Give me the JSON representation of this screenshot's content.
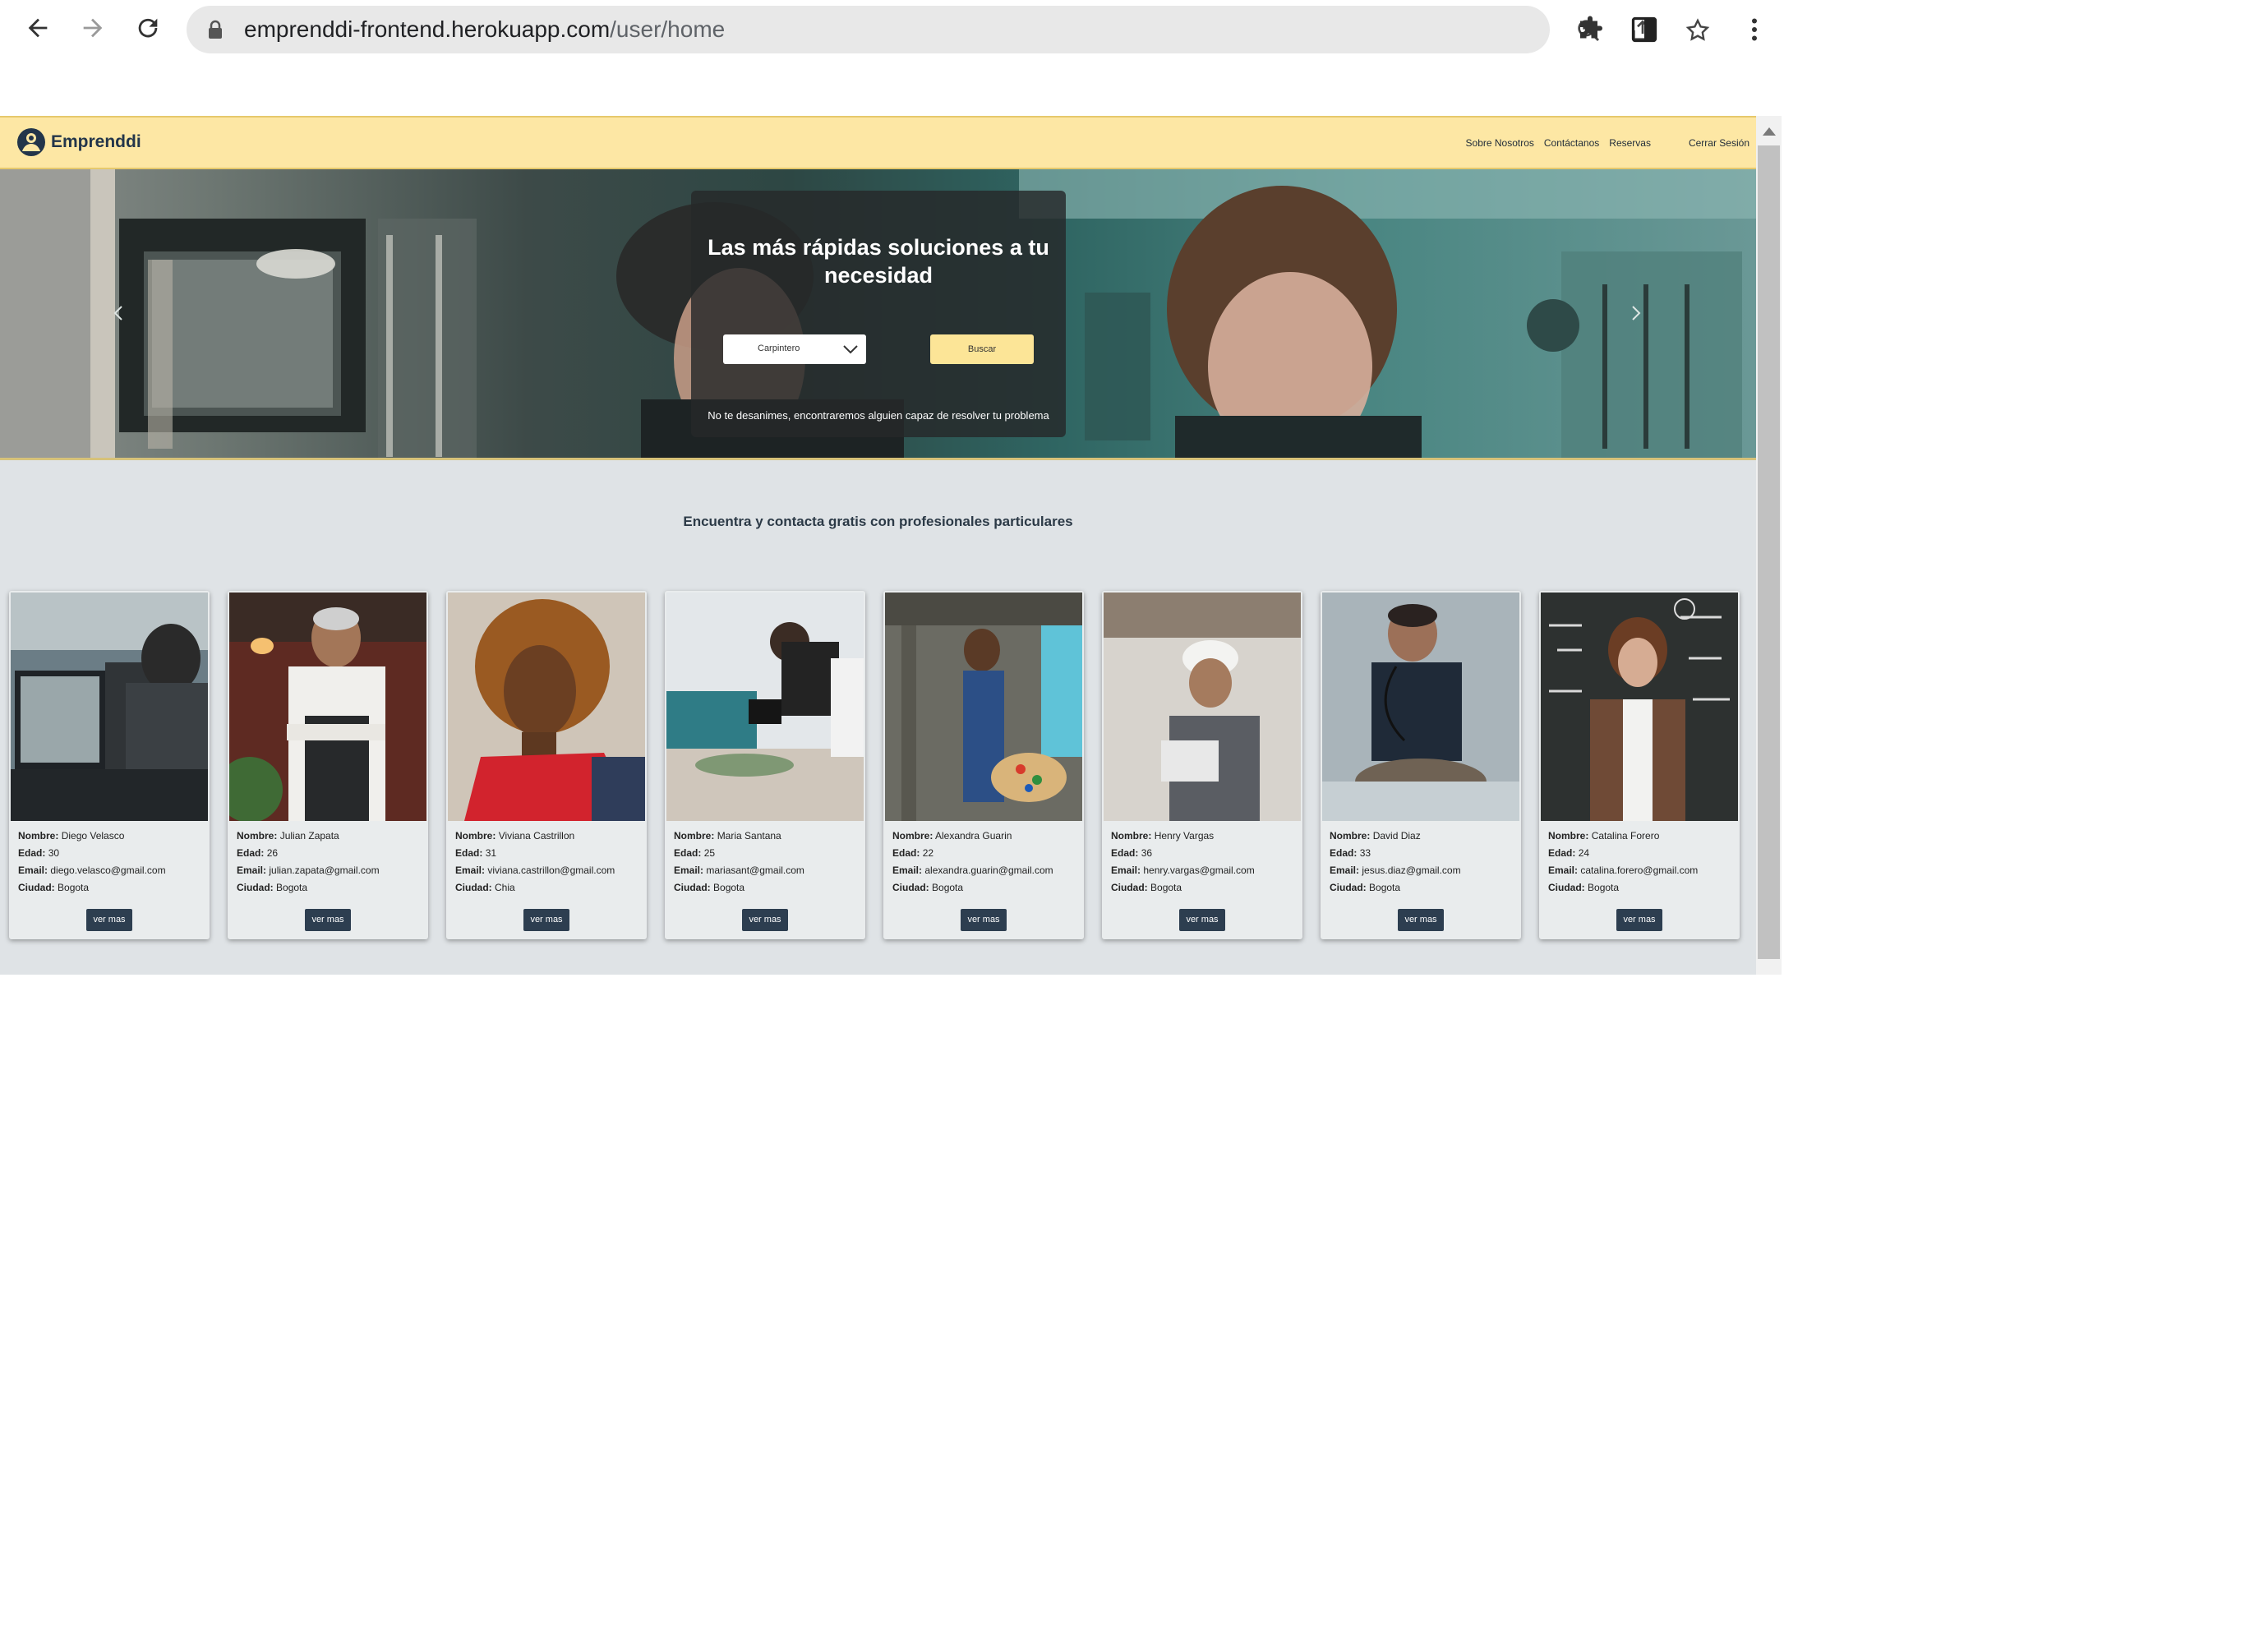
{
  "browser": {
    "url_domain": "emprenddi-frontend.herokuapp.com",
    "url_path": "/user/home"
  },
  "site": {
    "brand": "Emprenddi",
    "nav": {
      "about": "Sobre Nosotros",
      "contact": "Contáctanos",
      "bookings": "Reservas",
      "logout": "Cerrar Sesión"
    }
  },
  "hero": {
    "title": "Las más rápidas soluciones a tu necesidad",
    "select_value": "Carpintero",
    "search_label": "Buscar",
    "note": "No te desanimes, encontraremos alguien capaz de resolver tu problema"
  },
  "section": {
    "heading": "Encuentra y contacta gratis con profesionales particulares"
  },
  "labels": {
    "name": "Nombre:",
    "age": "Edad:",
    "email": "Email:",
    "city": "Ciudad:",
    "more": "ver mas"
  },
  "professionals": [
    {
      "name": "Diego Velasco",
      "age": "30",
      "email": "diego.velasco@gmail.com",
      "city": "Bogota"
    },
    {
      "name": "Julian Zapata",
      "age": "26",
      "email": "julian.zapata@gmail.com",
      "city": "Bogota"
    },
    {
      "name": "Viviana Castrillon",
      "age": "31",
      "email": "viviana.castrillon@gmail.com",
      "city": "Chia"
    },
    {
      "name": "Maria Santana",
      "age": "25",
      "email": "mariasant@gmail.com",
      "city": "Bogota"
    },
    {
      "name": "Alexandra Guarin",
      "age": "22",
      "email": "alexandra.guarin@gmail.com",
      "city": "Bogota"
    },
    {
      "name": "Henry Vargas",
      "age": "36",
      "email": "henry.vargas@gmail.com",
      "city": "Bogota"
    },
    {
      "name": "David Diaz",
      "age": "33",
      "email": "jesus.diaz@gmail.com",
      "city": "Bogota"
    },
    {
      "name": "Catalina Forero",
      "age": "24",
      "email": "catalina.forero@gmail.com",
      "city": "Bogota"
    }
  ],
  "colors": {
    "nav_bg": "#fde7a4",
    "button_dark": "#2d3e50",
    "button_yellow": "#fce597",
    "page_bg": "#dfe3e6"
  }
}
